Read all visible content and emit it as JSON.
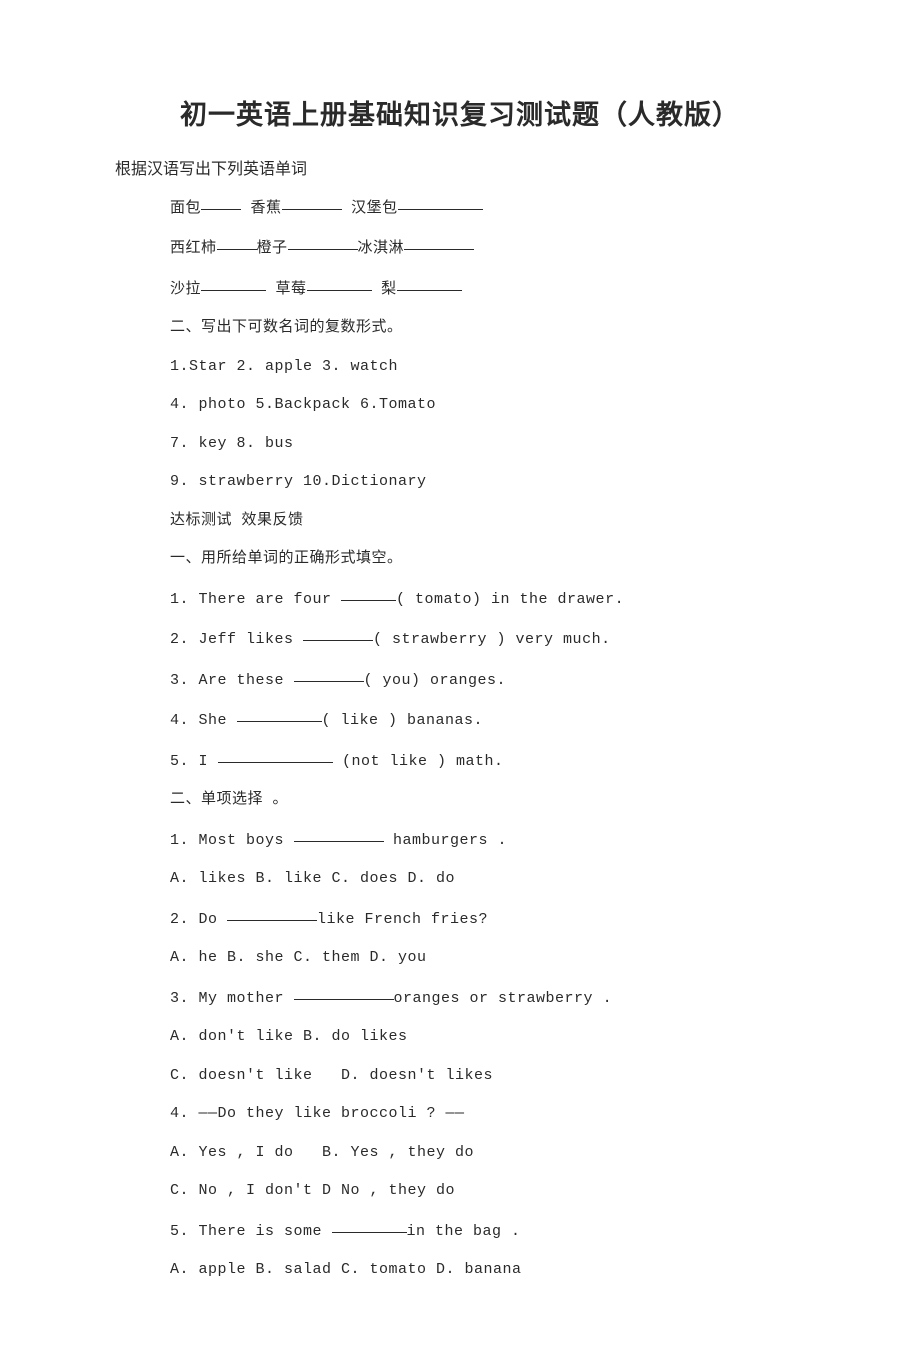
{
  "title": "初一英语上册基础知识复习测试题（人教版）",
  "subtitle": "根据汉语写出下列英语单词",
  "vocab": {
    "line1": {
      "a": "面包",
      "b": "香蕉",
      "c": "汉堡包"
    },
    "line2": {
      "a": "西红柿",
      "b": "橙子",
      "c": "冰淇淋"
    },
    "line3": {
      "a": "沙拉",
      "b": "草莓",
      "c": "梨"
    }
  },
  "section2_title": "二、写出下可数名词的复数形式。",
  "section2_items": [
    "1.Star 2. apple 3. watch",
    "4. photo 5.Backpack 6.Tomato",
    "7. key 8. bus",
    "9. strawberry 10.Dictionary"
  ],
  "test_title": "达标测试 效果反馈",
  "partA_title": "一、用所给单词的正确形式填空。",
  "partA": {
    "q1_pre": "1. There are four ",
    "q1_post": "( tomato) in the drawer.",
    "q2_pre": "2. Jeff likes ",
    "q2_post": "( strawberry ) very much.",
    "q3_pre": "3. Are these ",
    "q3_post": "( you) oranges.",
    "q4_pre": "4. She ",
    "q4_post": "( like ) bananas.",
    "q5_pre": "5. I ",
    "q5_post": " (not like ) math."
  },
  "partB_title": "二、单项选择 。",
  "partB": {
    "q1_pre": "1. Most boys ",
    "q1_post": " hamburgers .",
    "q1_opts": "A. likes B. like C. does D. do",
    "q2_pre": "2. Do ",
    "q2_post": "like French fries?",
    "q2_opts": "A. he B. she C. them D. you",
    "q3_pre": "3. My mother ",
    "q3_post": "oranges or strawberry .",
    "q3_opt1": "A. don't like B. do likes",
    "q3_opt2": "C. doesn't like   D. doesn't likes",
    "q4": "4. ——Do they like broccoli ? ——",
    "q4_opt1": "A. Yes , I do   B. Yes , they do",
    "q4_opt2": "C. No , I don't D No , they do",
    "q5_pre": "5. There is some ",
    "q5_post": "in the bag .",
    "q5_opts": "A. apple B. salad C. tomato D. banana"
  }
}
